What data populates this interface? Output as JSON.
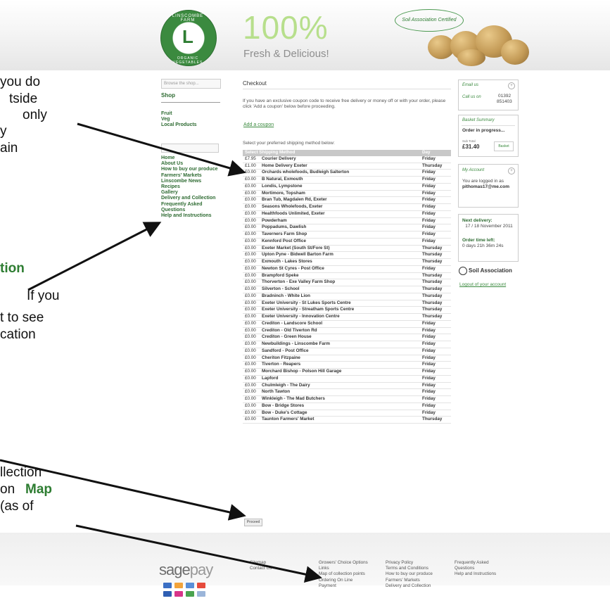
{
  "header": {
    "logo_top_text": "LINSCOMBE FARM",
    "logo_bottom_text": "ORGANIC VEGETABLES",
    "headline": "100%",
    "subheadline": "Fresh & Delicious!",
    "badge": "Soil Association Certified"
  },
  "sidebar": {
    "browse_placeholder": "Browse the shop...",
    "shop_label": "Shop",
    "categories": [
      "Fruit",
      "Veg",
      "Local Products"
    ],
    "nav_items": [
      "Home",
      "About Us",
      "How to buy our produce",
      "Farmers' Markets",
      "Linscombe News",
      "Recipes",
      "Gallery",
      "Delivery and Collection",
      "Frequently Asked",
      "Questions",
      "Help and Instructions"
    ]
  },
  "checkout": {
    "title": "Checkout",
    "intro": "If you have an exclusive coupon code to receive free delivery or money off or with your order, please click 'Add a coupon' below before proceeding.",
    "coupon_link": "Add a coupon",
    "select_label": "Select your preferred shipping method below:",
    "table_header": {
      "method": "Select Shipping Method",
      "day": "Day"
    },
    "rows": [
      {
        "price": "£7.95",
        "location": "Courier Delivery",
        "day": "Friday"
      },
      {
        "price": "£1.00",
        "location": "Home Delivery Exeter",
        "day": "Thursday"
      },
      {
        "price": "£0.00",
        "location": "Orchards wholefoods, Budleigh Salterton",
        "day": "Friday"
      },
      {
        "price": "£0.00",
        "location": "B Natural, Exmouth",
        "day": "Friday"
      },
      {
        "price": "£0.00",
        "location": "Londis, Lympstone",
        "day": "Friday"
      },
      {
        "price": "£0.00",
        "location": "Mortimore, Topsham",
        "day": "Friday"
      },
      {
        "price": "£0.00",
        "location": "Bran Tub, Magdalen Rd, Exeter",
        "day": "Friday"
      },
      {
        "price": "£0.00",
        "location": "Seasons Wholefoods, Exeter",
        "day": "Friday"
      },
      {
        "price": "£0.00",
        "location": "Healthfoods Unlimited, Exeter",
        "day": "Friday"
      },
      {
        "price": "£0.00",
        "location": "Powderham",
        "day": "Friday"
      },
      {
        "price": "£0.00",
        "location": "Poppadums, Dawlish",
        "day": "Friday"
      },
      {
        "price": "£0.00",
        "location": "Taverners Farm Shop",
        "day": "Friday"
      },
      {
        "price": "£0.00",
        "location": "Kennford Post Office",
        "day": "Friday"
      },
      {
        "price": "£0.00",
        "location": "Exeter Market (South St/Fore St)",
        "day": "Thursday"
      },
      {
        "price": "£0.00",
        "location": "Upton Pyne - Bidwell Barton Farm",
        "day": "Thursday"
      },
      {
        "price": "£0.00",
        "location": "Exmouth - Lakes Stores",
        "day": "Thursday"
      },
      {
        "price": "£0.00",
        "location": "Newton St Cyres - Post Office",
        "day": "Friday"
      },
      {
        "price": "£0.00",
        "location": "Brampford Speke",
        "day": "Thursday"
      },
      {
        "price": "£0.00",
        "location": "Thorverton - Exe Valley Farm Shop",
        "day": "Thursday"
      },
      {
        "price": "£0.00",
        "location": "Silverton - School",
        "day": "Thursday"
      },
      {
        "price": "£0.00",
        "location": "Bradninch - White Lion",
        "day": "Thursday"
      },
      {
        "price": "£0.00",
        "location": "Exeter University - St Lukes Sports Centre",
        "day": "Thursday"
      },
      {
        "price": "£0.00",
        "location": "Exeter University - Streatham Sports Centre",
        "day": "Thursday"
      },
      {
        "price": "£0.00",
        "location": "Exeter University - Innovation Centre",
        "day": "Thursday"
      },
      {
        "price": "£0.00",
        "location": "Crediton - Landscore School",
        "day": "Friday"
      },
      {
        "price": "£0.00",
        "location": "Crediton - Old Tiverton Rd",
        "day": "Friday"
      },
      {
        "price": "£0.00",
        "location": "Crediton - Green House",
        "day": "Friday"
      },
      {
        "price": "£0.00",
        "location": "Newbuildings - Linscombe Farm",
        "day": "Friday"
      },
      {
        "price": "£0.00",
        "location": "Sandford - Post Office",
        "day": "Friday"
      },
      {
        "price": "£0.00",
        "location": "Cheriton Fitzpaine",
        "day": "Friday"
      },
      {
        "price": "£0.00",
        "location": "Tiverton - Reapers",
        "day": "Friday"
      },
      {
        "price": "£0.00",
        "location": "Morchard Bishop - Polson Hill Garage",
        "day": "Friday"
      },
      {
        "price": "£0.00",
        "location": "Lapford",
        "day": "Friday"
      },
      {
        "price": "£0.00",
        "location": "Chulmleigh - The Dairy",
        "day": "Friday"
      },
      {
        "price": "£0.00",
        "location": "North Tawton",
        "day": "Friday"
      },
      {
        "price": "£0.00",
        "location": "Winkleigh - The Mad Butchers",
        "day": "Friday"
      },
      {
        "price": "£0.00",
        "location": "Bow - Bridge Stores",
        "day": "Friday"
      },
      {
        "price": "£0.00",
        "location": "Bow - Duke's Cottage",
        "day": "Friday"
      },
      {
        "price": "£0.00",
        "location": "Taunton Farmers' Market",
        "day": "Thursday"
      }
    ],
    "proceed_label": "Proceed"
  },
  "right": {
    "contact_title": "Email us",
    "call_label": "Call us on",
    "phone_1": "01392",
    "phone_2": "851403",
    "basket_title": "Basket Summary",
    "basket_status": "Order in progress...",
    "total_label": "Sub Total",
    "total": "£31.40",
    "basket_button": "Basket",
    "account_title": "My Account",
    "logged_in_label": "You are logged in as",
    "user_email": "pithomas17@me.com",
    "next_delivery_label": "Next delivery:",
    "next_delivery_value": "17 / 18 November 2011",
    "order_time_label": "Order time left:",
    "order_time_value": "0 days 21h 36m 24s",
    "soil_label": "Soil Association",
    "logout_label": "Logout of your account"
  },
  "footer": {
    "sagepay": "sage",
    "sagepay2": "pay",
    "col1": [
      "Sitemap",
      "Contact Us"
    ],
    "col2": [
      "Growers' Choice Options",
      "Links",
      "Map of collection points",
      "Ordering On Line",
      "Payment"
    ],
    "col3": [
      "Privacy Policy",
      "Terms and Conditions",
      "How to buy our produce",
      "Farmers' Markets",
      "Delivery and Collection"
    ],
    "col4": [
      "Frequently Asked",
      "Questions",
      "Help and Instructions"
    ]
  },
  "overlay": {
    "lines": [
      {
        "text": "you do",
        "green": false
      },
      {
        "text": "tside",
        "green": false
      },
      {
        "text": "only",
        "green": false
      },
      {
        "text": "y",
        "green": false
      },
      {
        "text": "ain",
        "green": false
      },
      {
        "text": "tion",
        "green": true
      },
      {
        "text": "If you",
        "green": false
      },
      {
        "text": "t to see",
        "green": false
      },
      {
        "text": "cation",
        "green": false
      },
      {
        "text": "llection",
        "green": false
      },
      {
        "text": "on",
        "green": false
      },
      {
        "text": "Map",
        "green": true
      },
      {
        "text": "(as of",
        "green": false
      }
    ]
  },
  "colors": {
    "brand_green": "#3b8a3f",
    "nav_green": "#2e6b32",
    "header_green": "#b7df8c",
    "table_head": "#c8c8c8"
  }
}
